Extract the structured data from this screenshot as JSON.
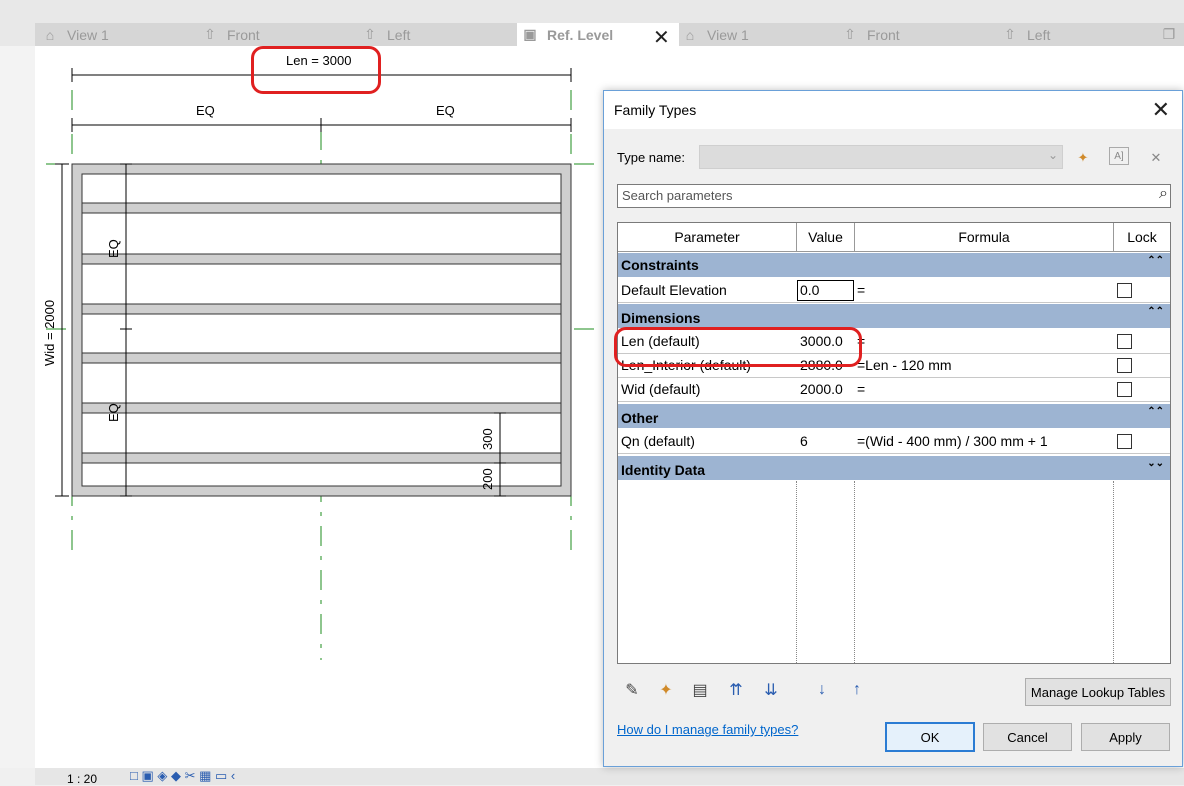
{
  "tabs": [
    {
      "label": "View 1",
      "icon": "house-3d-icon"
    },
    {
      "label": "Front",
      "icon": "elevation-icon"
    },
    {
      "label": "Left",
      "icon": "elevation-icon"
    },
    {
      "label": "Ref. Level",
      "icon": "floor-plan-icon",
      "active": true
    },
    {
      "label": "View 1",
      "icon": "house-3d-icon"
    },
    {
      "label": "Front",
      "icon": "elevation-icon"
    },
    {
      "label": "Left",
      "icon": "elevation-icon"
    }
  ],
  "drawing": {
    "len_label": "Len = 3000",
    "eq_left": "EQ",
    "eq_right": "EQ",
    "wid_label": "Wid = 2000",
    "eq_top": "EQ",
    "eq_bottom": "EQ",
    "dim_300": "300",
    "dim_200": "200"
  },
  "status": {
    "scale": "1 : 20"
  },
  "dialog": {
    "title": "Family Types",
    "type_name_label": "Type name:",
    "search_placeholder": "Search parameters",
    "columns": {
      "parameter": "Parameter",
      "value": "Value",
      "formula": "Formula",
      "lock": "Lock"
    },
    "groups": {
      "constraints": "Constraints",
      "dimensions": "Dimensions",
      "other": "Other",
      "identity": "Identity Data"
    },
    "rows": {
      "default_elevation": {
        "param": "Default Elevation",
        "value": "0.0",
        "formula": "="
      },
      "len": {
        "param": "Len (default)",
        "value": "3000.0",
        "formula": "="
      },
      "len_interior": {
        "param": "Len_Interior (default)",
        "value": "2880.0",
        "formula": "=Len - 120 mm"
      },
      "wid": {
        "param": "Wid (default)",
        "value": "2000.0",
        "formula": "="
      },
      "qn": {
        "param": "Qn (default)",
        "value": "6",
        "formula": "=(Wid - 400 mm) / 300 mm + 1"
      }
    },
    "manage_lookup": "Manage Lookup Tables",
    "help_link": "How do I manage family types?",
    "ok": "OK",
    "cancel": "Cancel",
    "apply": "Apply"
  }
}
